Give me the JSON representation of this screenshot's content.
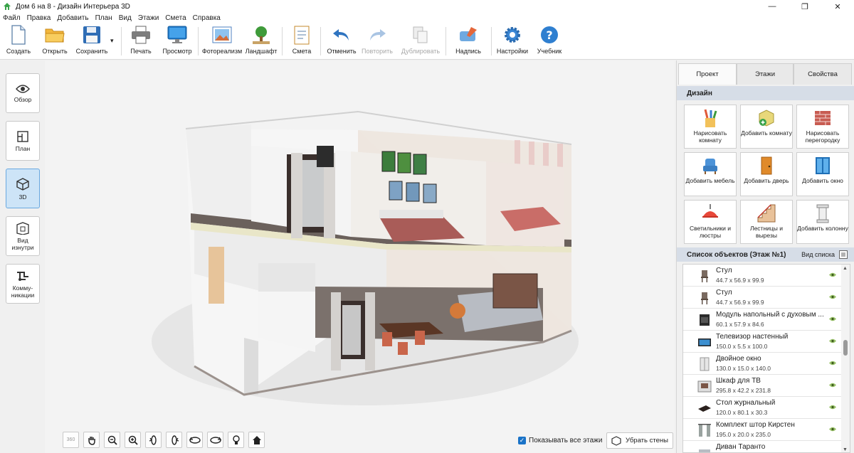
{
  "window": {
    "title": "Дом 6 на 8 - Дизайн Интерьера 3D",
    "minimize": "—",
    "maximize": "❐",
    "close": "✕"
  },
  "menu": [
    "Файл",
    "Правка",
    "Добавить",
    "План",
    "Вид",
    "Этажи",
    "Смета",
    "Справка"
  ],
  "toolbar": {
    "create": "Создать",
    "open": "Открыть",
    "save": "Сохранить",
    "save_more": "▾",
    "print": "Печать",
    "preview": "Просмотр",
    "photorealism": "Фотореализм",
    "landscape": "Ландшафт",
    "estimate": "Смета",
    "undo": "Отменить",
    "redo": "Повторить",
    "duplicate": "Дублировать",
    "label": "Надпись",
    "settings": "Настройки",
    "tutorial": "Учебник"
  },
  "views": [
    {
      "label": "Обзор",
      "active": false
    },
    {
      "label": "План",
      "active": false
    },
    {
      "label": "3D",
      "active": true
    },
    {
      "label": "Вид изнутри",
      "active": false
    },
    {
      "label": "Комму-никации",
      "active": false
    }
  ],
  "bottom": {
    "show_all_floors": "Показывать все этажи",
    "show_all_floors_checked": true,
    "remove_walls": "Убрать стены",
    "orbit_label": "360"
  },
  "panel": {
    "tabs": [
      "Проект",
      "Этажи",
      "Свойства"
    ],
    "active_tab": "Проект",
    "design_header": "Дизайн",
    "design_items": [
      "Нарисовать комнату",
      "Добавить комнату",
      "Нарисовать перегородку",
      "Добавить мебель",
      "Добавить дверь",
      "Добавить окно",
      "Светильники и люстры",
      "Лестницы и вырезы",
      "Добавить колонну"
    ],
    "objects_header": "Список объектов (Этаж №1)",
    "view_list": "Вид списка",
    "objects": [
      {
        "name": "Стул",
        "dims": "44.7 x 56.9 x 99.9"
      },
      {
        "name": "Стул",
        "dims": "44.7 x 56.9 x 99.9"
      },
      {
        "name": "Модуль напольный с духовым ...",
        "dims": "60.1 x 57.9 x 84.6"
      },
      {
        "name": "Телевизор настенный",
        "dims": "150.0 x 5.5 x 100.0"
      },
      {
        "name": "Двойное окно",
        "dims": "130.0 x 15.0 x 140.0"
      },
      {
        "name": "Шкаф для ТВ",
        "dims": "295.8 x 42.2 x 231.8"
      },
      {
        "name": "Стол журнальный",
        "dims": "120.0 x 80.1 x 30.3"
      },
      {
        "name": "Комплект штор Кирстен",
        "dims": "195.0 x 20.0 x 235.0"
      },
      {
        "name": "Диван Таранто",
        "dims": ""
      }
    ]
  },
  "colors": {
    "accent": "#1a73c8",
    "active_view": "#cde4f7",
    "section_header": "#d6dde7"
  }
}
